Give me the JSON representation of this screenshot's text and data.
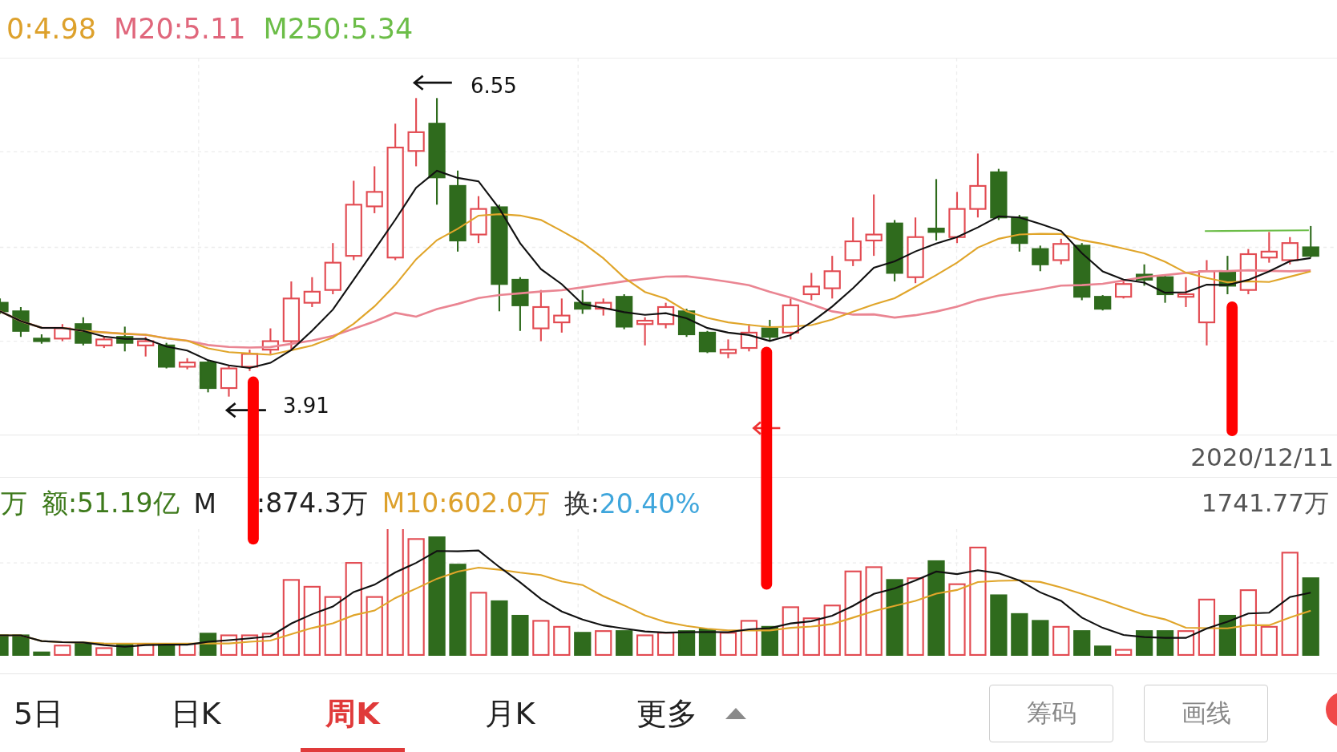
{
  "indicators": [
    {
      "text": "0:4.98",
      "color": "#dda12c"
    },
    {
      "text": "M20:5.11",
      "color": "#e0677c"
    },
    {
      "text": "M250:5.34",
      "color": "#6cbd48"
    }
  ],
  "price_chart": {
    "high_label": "6.55",
    "low_label": "3.91"
  },
  "date": "2020/12/11",
  "volume_labels": [
    {
      "text": "万",
      "color": "#3e7a1c"
    },
    {
      "text": "额:51.19亿",
      "color": "#3e7a1c"
    },
    {
      "text": "M",
      "color": "#222222"
    },
    {
      "text": ":874.3万",
      "color": "#222222"
    },
    {
      "text": "M10:602.0万",
      "color": "#dda12c"
    },
    {
      "text": "换:",
      "color": "#333333"
    },
    {
      "text": "20.40%",
      "color": "#3fa6dc"
    }
  ],
  "volume_value": "1741.77万",
  "tabs": [
    {
      "label": "5日",
      "selected": false
    },
    {
      "label": "日K",
      "selected": false
    },
    {
      "label": "周K",
      "selected": true
    },
    {
      "label": "月K",
      "selected": false
    },
    {
      "label": "更多",
      "selected": false
    }
  ],
  "buttons": [
    "筹码",
    "画线"
  ]
}
